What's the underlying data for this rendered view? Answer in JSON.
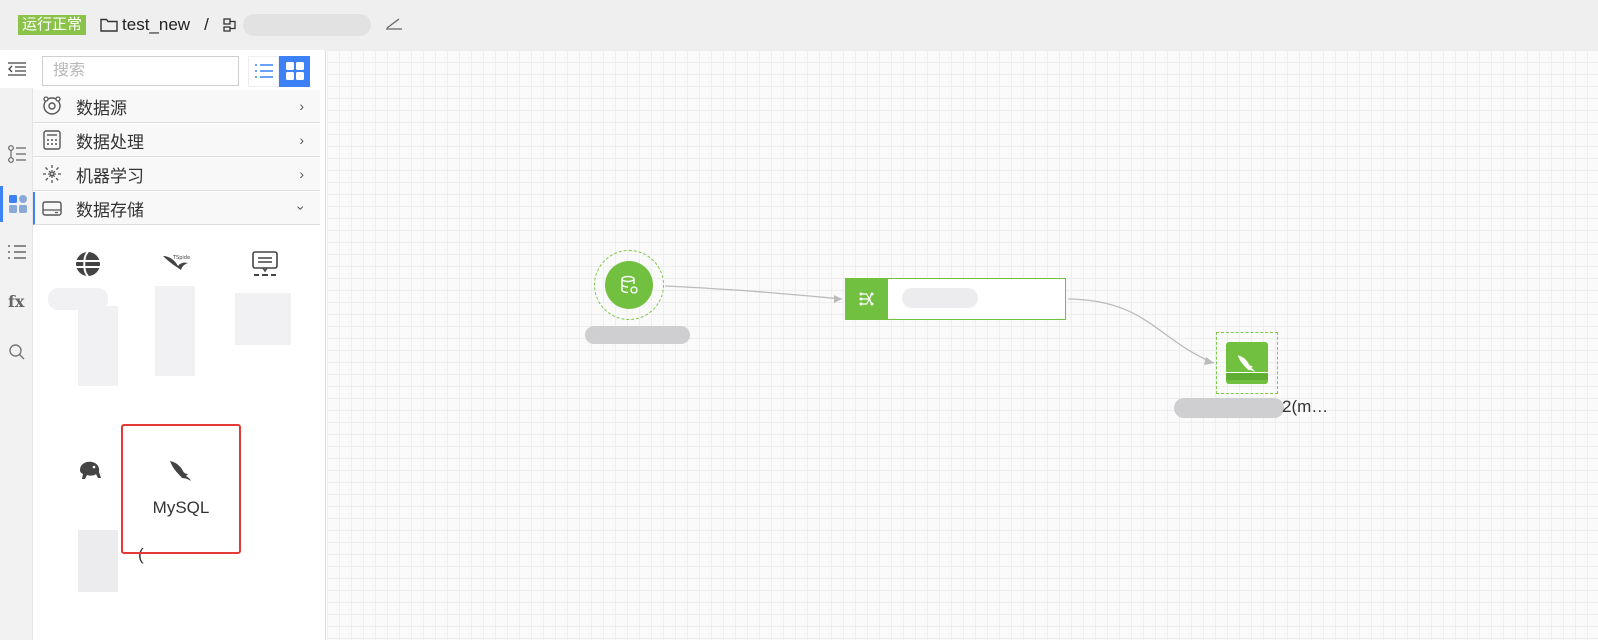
{
  "header": {
    "status": "运行正常",
    "project": "test_new",
    "separator": "/"
  },
  "panel": {
    "search_placeholder": "搜索",
    "categories": [
      {
        "label": "数据源",
        "icon": "datasource-icon",
        "expanded": false
      },
      {
        "label": "数据处理",
        "icon": "calculator-icon",
        "expanded": false
      },
      {
        "label": "机器学习",
        "icon": "snowflake-icon",
        "expanded": false
      },
      {
        "label": "数据存储",
        "icon": "drive-icon",
        "expanded": true
      }
    ],
    "storage_tiles": [
      {
        "label": "",
        "icon": "globe-db-icon"
      },
      {
        "label": "",
        "icon": "tspider-icon"
      },
      {
        "label": "",
        "icon": "message-board-icon"
      },
      {
        "label": "(",
        "icon": "hadoop-elephant-icon"
      },
      {
        "label": "MySQL",
        "icon": "mysql-dolphin-icon",
        "selected": true
      }
    ]
  },
  "canvas": {
    "source_node": {
      "label": "",
      "icon": "database-icon"
    },
    "process_node": {
      "label": "",
      "icon": "flow-icon"
    },
    "sink_node": {
      "label": "2(m…",
      "icon": "mysql-dolphin-icon"
    }
  },
  "colors": {
    "status_green": "#8bc34a",
    "node_green": "#72c040",
    "accent_blue": "#3c82f6",
    "selection_red": "#e53935"
  }
}
